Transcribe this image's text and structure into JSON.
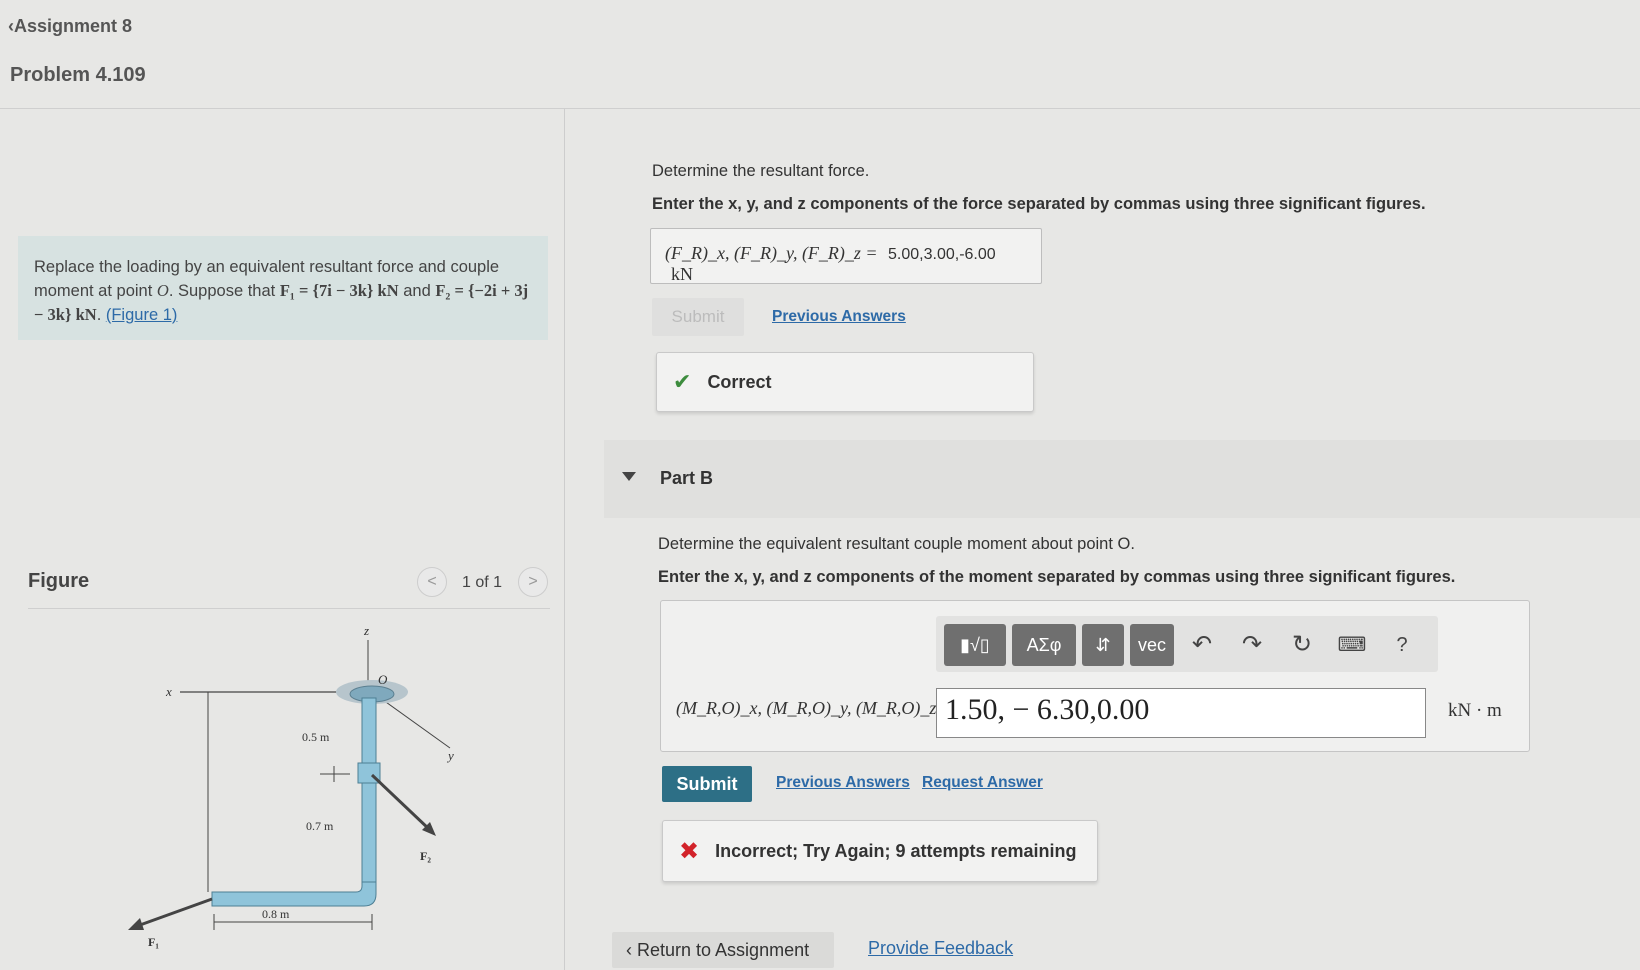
{
  "header": {
    "back_label": "Assignment 8",
    "problem_title": "Problem 4.109"
  },
  "problem": {
    "text_1": "Replace the loading by an equivalent resultant force and couple moment at point ",
    "point": "O",
    "text_2": ". Suppose that ",
    "f1": "F₁ = {7i − 3k} kN",
    "text_3": " and ",
    "f2": "F₂ = {−2i + 3j − 3k} kN",
    "text_4": ". ",
    "figure_link": "(Figure 1)"
  },
  "figure": {
    "title": "Figure",
    "count": "1 of 1",
    "prev": "<",
    "next": ">",
    "labels": {
      "z": "z",
      "x": "x",
      "y": "y",
      "o": "O",
      "d1": "0.5 m",
      "d2": "0.7 m",
      "d3": "0.8 m",
      "f1": "F₁",
      "f2": "F₂"
    }
  },
  "part_a": {
    "prompt": "Determine the resultant force.",
    "instruction": "Enter the x, y, and z components of the force separated by commas using three significant figures.",
    "answer_label": "(F_R)_x, (F_R)_y, (F_R)_z =",
    "answer_value": "5.00,3.00,-6.00",
    "unit": "kN",
    "submit_label": "Submit",
    "previous_answers": "Previous Answers",
    "feedback": "Correct"
  },
  "part_b": {
    "label": "Part B",
    "prompt": "Determine the equivalent resultant couple moment about point O.",
    "instruction": "Enter the x, y, and z components of the moment separated by commas using three significant figures.",
    "answer_label": "(M_R,O)_x, (M_R,O)_y, (M_R,O)_z =",
    "answer_value": "1.50, − 6.30,0.00",
    "unit": "kN · m",
    "toolbar": {
      "templates": "▮√▯",
      "greek": "ΑΣφ",
      "arrows": "⇵",
      "vec": "vec",
      "help": "?"
    },
    "submit_label": "Submit",
    "previous_answers": "Previous Answers",
    "request_answer": "Request Answer",
    "feedback": "Incorrect; Try Again; 9 attempts remaining"
  },
  "footer": {
    "return_label": "Return to Assignment",
    "feedback_link": "Provide Feedback"
  }
}
